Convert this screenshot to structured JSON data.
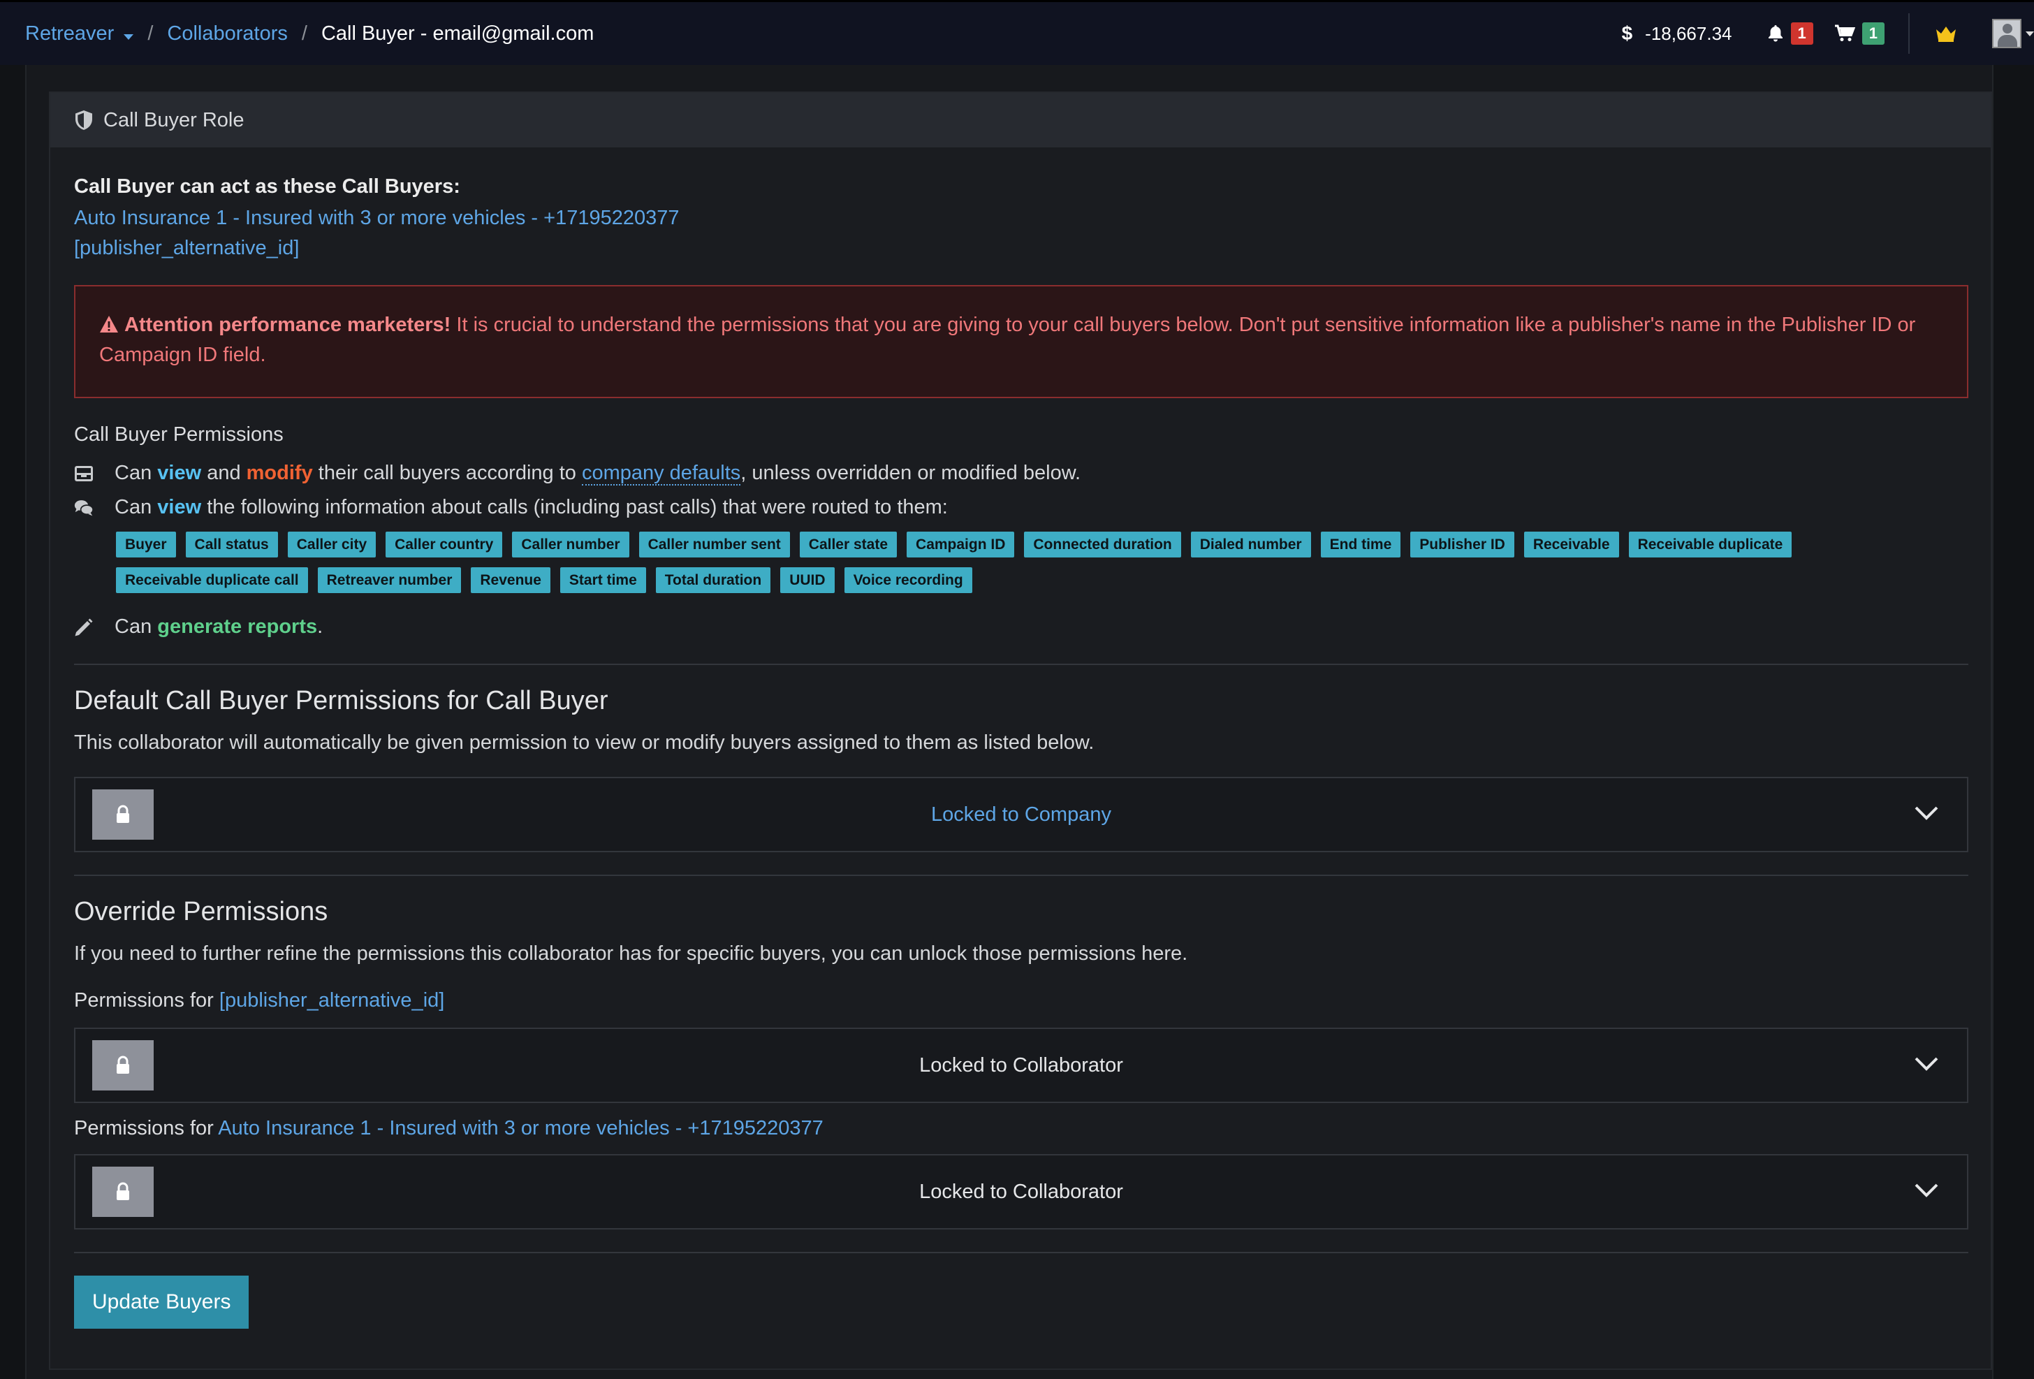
{
  "topbar": {
    "brand": "Retreaver",
    "breadcrumb_sep": "/",
    "breadcrumb_collaborators": "Collaborators",
    "breadcrumb_current": "Call Buyer - email@gmail.com",
    "balance_symbol": "$",
    "balance": "-18,667.34",
    "notifications_count": "1",
    "cart_count": "1"
  },
  "panel": {
    "title": "Call Buyer Role",
    "acts_label": "Call Buyer can act as these Call Buyers:",
    "acts_items": [
      "Auto Insurance 1 - Insured with 3 or more vehicles - +17195220377",
      "[publisher_alternative_id]"
    ],
    "alert": {
      "strong": "Attention performance marketers!",
      "text": " It is crucial to understand the permissions that you are giving to your call buyers below. Don't put sensitive information like a publisher's name in the Publisher ID or Campaign ID field."
    },
    "permissions": {
      "title": "Call Buyer Permissions",
      "row1": {
        "can": "Can ",
        "view": "view",
        "and": " and ",
        "modify": "modify",
        "mid": " their call buyers according to ",
        "link": "company defaults",
        "tail": ", unless overridden or modified below."
      },
      "row2": {
        "can": "Can ",
        "view": "view",
        "tail": " the following information about calls (including past calls) that were routed to them:"
      },
      "tags": [
        "Buyer",
        "Call status",
        "Caller city",
        "Caller country",
        "Caller number",
        "Caller number sent",
        "Caller state",
        "Campaign ID",
        "Connected duration",
        "Dialed number",
        "End time",
        "Publisher ID",
        "Receivable",
        "Receivable duplicate",
        "Receivable duplicate call",
        "Retreaver number",
        "Revenue",
        "Start time",
        "Total duration",
        "UUID",
        "Voice recording"
      ],
      "row3": {
        "can": "Can ",
        "generate": "generate reports",
        "tail": "."
      }
    },
    "default_section": {
      "heading": "Default Call Buyer Permissions for Call Buyer",
      "desc": "This collaborator will automatically be given permission to view or modify buyers assigned to them as listed below.",
      "lock_label": "Locked to Company"
    },
    "override_section": {
      "heading": "Override Permissions",
      "desc": "If you need to further refine the permissions this collaborator has for specific buyers, you can unlock those permissions here.",
      "permissions_for": "Permissions for ",
      "items": [
        {
          "target": "[publisher_alternative_id]",
          "lock_label": "Locked to Collaborator"
        },
        {
          "target": "Auto Insurance 1 - Insured with 3 or more vehicles - +17195220377",
          "lock_label": "Locked to Collaborator"
        }
      ]
    },
    "update_button": "Update Buyers"
  },
  "colors": {
    "topbar_bg": "#101321",
    "link": "#5ea6e6",
    "tag_bg": "#3eadc5",
    "alert_bg": "#2b1517",
    "alert_border": "#8a2d2e",
    "badge_red": "#d0352e",
    "badge_green": "#3ea172",
    "button": "#2e8fa8"
  },
  "icons": {
    "role": "shield-icon",
    "alert": "warning-triangle-icon",
    "modify": "inbox-tray-icon",
    "view_calls": "comments-icon",
    "reports": "pencil-icon",
    "lock": "lock-icon",
    "expand": "chevron-down-icon",
    "notifications": "bell-icon",
    "cart": "cart-icon",
    "premium": "crown-icon"
  }
}
